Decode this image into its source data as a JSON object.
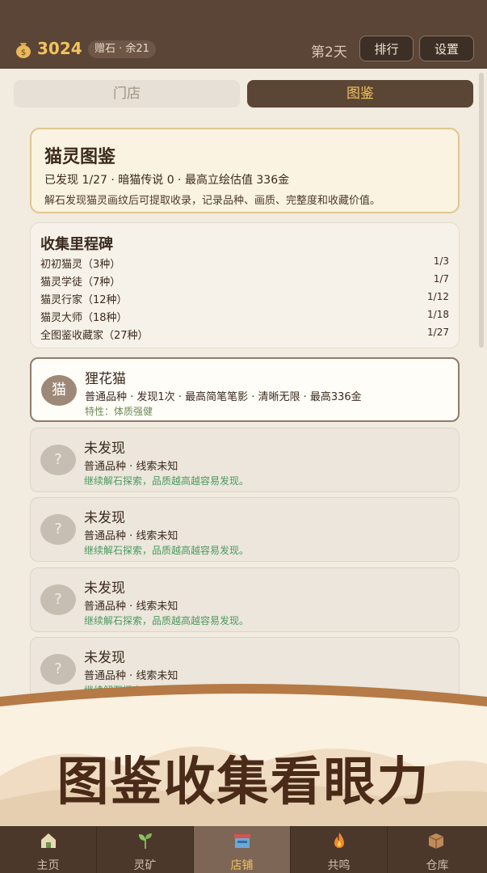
{
  "header": {
    "coins": "3024",
    "gift_pill": "赠石 · 余21",
    "day": "第2天",
    "rank_label": "排行",
    "settings_label": "设置"
  },
  "tabs": [
    {
      "label": "门店",
      "active": false
    },
    {
      "label": "图鉴",
      "active": true
    }
  ],
  "summary": {
    "title": "猫灵图鉴",
    "stats": "已发现 1/27 · 暗猫传说 0 · 最高立绘估值 336金",
    "desc": "解石发现猫灵画纹后可提取收录，记录品种、画质、完整度和收藏价值。"
  },
  "milestones": {
    "title": "收集里程碑",
    "items": [
      {
        "name": "初初猫灵（3种）",
        "progress": "1/3"
      },
      {
        "name": "猫灵学徒（7种）",
        "progress": "1/7"
      },
      {
        "name": "猫灵行家（12种）",
        "progress": "1/12"
      },
      {
        "name": "猫灵大师（18种）",
        "progress": "1/18"
      },
      {
        "name": "全图鉴收藏家（27种）",
        "progress": "1/27"
      }
    ]
  },
  "cats": [
    {
      "avatar": "猫",
      "name": "狸花猫",
      "meta": "普通品种 · 发现1次 · 最高简笔笔影 · 清晰无限 · 最高336金",
      "note": "特性：体质强健",
      "found": true
    },
    {
      "avatar": "?",
      "name": "未发现",
      "meta": "普通品种 · 线索未知",
      "note": "继续解石探索，品质越高越容易发现。",
      "found": false
    },
    {
      "avatar": "?",
      "name": "未发现",
      "meta": "普通品种 · 线索未知",
      "note": "继续解石探索，品质越高越容易发现。",
      "found": false
    },
    {
      "avatar": "?",
      "name": "未发现",
      "meta": "普通品种 · 线索未知",
      "note": "继续解石探索，品质越高越容易发现。",
      "found": false
    },
    {
      "avatar": "?",
      "name": "未发现",
      "meta": "普通品种 · 线索未知",
      "note": "继续解石探索，品质越高越容易发现。",
      "found": false
    }
  ],
  "banner": {
    "text": "图鉴收集看眼力"
  },
  "nav": [
    {
      "label": "主页",
      "icon": "home-icon",
      "active": false
    },
    {
      "label": "灵矿",
      "icon": "sprout-icon",
      "active": false
    },
    {
      "label": "店铺",
      "icon": "shop-icon",
      "active": true
    },
    {
      "label": "共鸣",
      "icon": "fire-icon",
      "active": false
    },
    {
      "label": "仓库",
      "icon": "box-icon",
      "active": false
    }
  ],
  "colors": {
    "topbar": "#5a4536",
    "accent_gold": "#f3c25d",
    "note_green": "#4b9a5f"
  }
}
